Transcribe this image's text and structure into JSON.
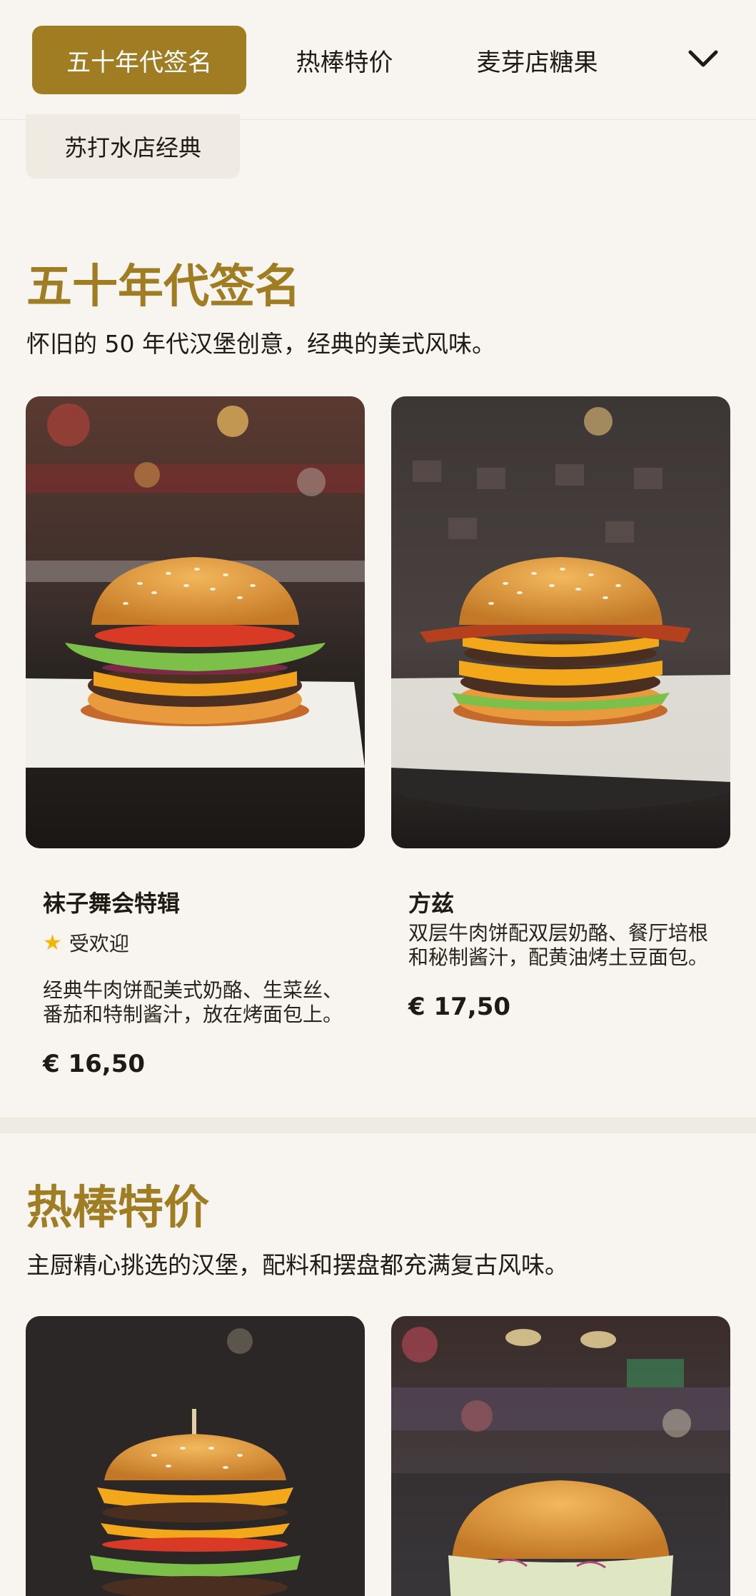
{
  "nav": {
    "tabs": [
      {
        "label": "五十年代签名",
        "active": true
      },
      {
        "label": "热棒特价",
        "active": false
      },
      {
        "label": "麦芽店糖果",
        "active": false
      },
      {
        "label": "苏打水店经典",
        "active": false
      }
    ],
    "more_icon": "chevron-down-icon"
  },
  "sections": [
    {
      "title": "五十年代签名",
      "description": "怀旧的 50 年代汉堡创意，经典的美式风味。",
      "items": [
        {
          "name": "袜子舞会特辑",
          "badge": "受欢迎",
          "badge_icon": "star-icon",
          "description": "经典牛肉饼配美式奶酪、生菜丝、番茄和特制酱汁，放在烤面包上。",
          "price": "€ 16,50"
        },
        {
          "name": "方兹",
          "description": "双层牛肉饼配双层奶酪、餐厅培根和秘制酱汁，配黄油烤土豆面包。",
          "price": "€ 17,50"
        }
      ]
    },
    {
      "title": "热棒特价",
      "description": "主厨精心挑选的汉堡，配料和摆盘都充满复古风味。",
      "items": []
    }
  ],
  "colors": {
    "accent": "#a07d22",
    "background": "#f8f5f0",
    "star": "#f2b705"
  }
}
